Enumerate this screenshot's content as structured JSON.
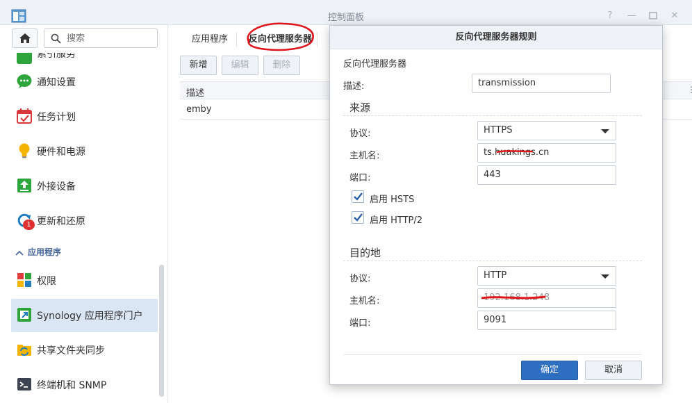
{
  "window": {
    "title": "控制面板"
  },
  "sidebar": {
    "search_placeholder": "搜索",
    "partial_item": "索引服务",
    "items": [
      {
        "label": "通知设置"
      },
      {
        "label": "任务计划"
      },
      {
        "label": "硬件和电源"
      },
      {
        "label": "外接设备"
      },
      {
        "label": "更新和还原",
        "badge": "1"
      }
    ],
    "section_title": "应用程序",
    "app_items": [
      {
        "label": "权限"
      },
      {
        "label": "Synology 应用程序门户"
      },
      {
        "label": "共享文件夹同步"
      },
      {
        "label": "终端机和 SNMP"
      }
    ]
  },
  "main": {
    "tabs": [
      {
        "label": "应用程序"
      },
      {
        "label": "反向代理服务器"
      }
    ],
    "toolbar": {
      "add": "新增",
      "edit": "编辑",
      "delete": "删除"
    },
    "table": {
      "headers": [
        "描述"
      ],
      "rows": [
        {
          "description": "emby"
        }
      ]
    }
  },
  "dialog": {
    "title": "反向代理服务器规则",
    "section": "反向代理服务器",
    "description_label": "描述:",
    "description_value": "transmission",
    "source": {
      "title": "来源",
      "protocol_label": "协议:",
      "protocol_value": "HTTPS",
      "hostname_label": "主机名:",
      "hostname_value": "ts.huakings.cn",
      "port_label": "端口:",
      "port_value": "443",
      "hsts_label": "启用 HSTS",
      "http2_label": "启用 HTTP/2"
    },
    "destination": {
      "title": "目的地",
      "protocol_label": "协议:",
      "protocol_value": "HTTP",
      "hostname_label": "主机名:",
      "hostname_value": "192.168.1.248",
      "port_label": "端口:",
      "port_value": "9091"
    },
    "ok": "确定",
    "cancel": "取消"
  },
  "colors": {
    "accent": "#2a6fc4",
    "annotation": "#e0141b",
    "active_item_bg": "#dbe6f5"
  }
}
